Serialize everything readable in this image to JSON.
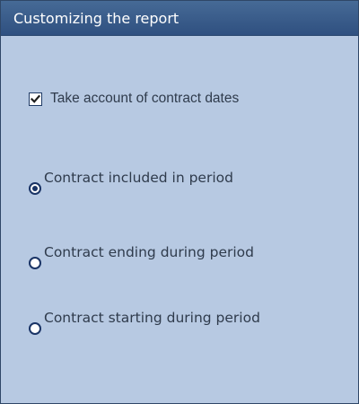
{
  "panel": {
    "title": "Customizing the report"
  },
  "checkbox": {
    "label": "Take account of contract dates",
    "checked": true
  },
  "radio_options": [
    {
      "label": "Contract included in period",
      "selected": true
    },
    {
      "label": "Contract ending during period",
      "selected": false
    },
    {
      "label": "Contract starting during period",
      "selected": false
    }
  ],
  "colors": {
    "panel_background": "#b7c9e2",
    "header_background": "#3a5e8c",
    "text": "#2f3b4c",
    "control_border": "#1a3466"
  }
}
